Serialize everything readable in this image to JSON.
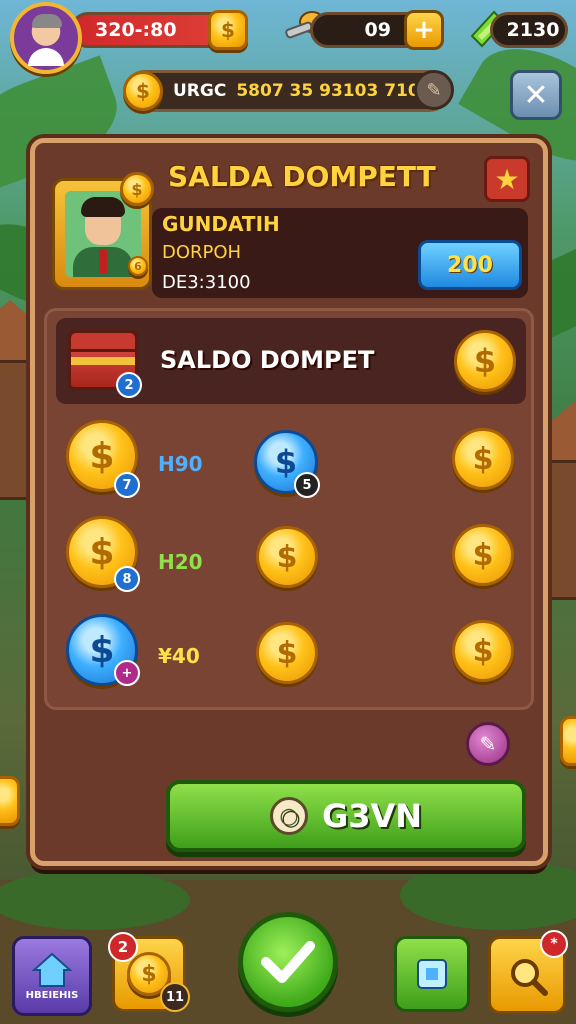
{
  "hud": {
    "health_value": "320-:80",
    "middle_value": "09",
    "right_value": "2130",
    "currency_prefix": "URGC",
    "currency_value": "5807 35 93103 710"
  },
  "panel": {
    "title": "SALDA DOMPETT",
    "profile_name": "GUNDATIH",
    "profile_sub": "DORPOH",
    "profile_id": "DE3:3100",
    "profile_value_button": "200",
    "profile_badge": "6"
  },
  "wallet": {
    "section_title": "SALDO DOMPET",
    "chest_badge": "2",
    "rows": [
      {
        "amount": "H90",
        "amount_color": "#4fb0ff",
        "left_badge": "7",
        "mid_badge": "5"
      },
      {
        "amount": "H20",
        "amount_color": "#8fe04a",
        "left_badge": "8",
        "mid_badge": ""
      },
      {
        "amount": "¥40",
        "amount_color": "#ffe14a",
        "left_badge": "+",
        "mid_badge": ""
      }
    ]
  },
  "action": {
    "main_button_label": "G3VN",
    "small_button_icon": "pen-icon"
  },
  "bottom": {
    "shop_label": "HBEIEHIS",
    "coins_badge": "2",
    "coins_count": "11",
    "notify_badge": "*"
  },
  "colors": {
    "panel_bg": "#6b3a2a",
    "panel_border": "#d8a06a",
    "title_yellow": "#ffd23f",
    "green_button": "#3f9f1a",
    "blue_button": "#1f8ae0"
  }
}
